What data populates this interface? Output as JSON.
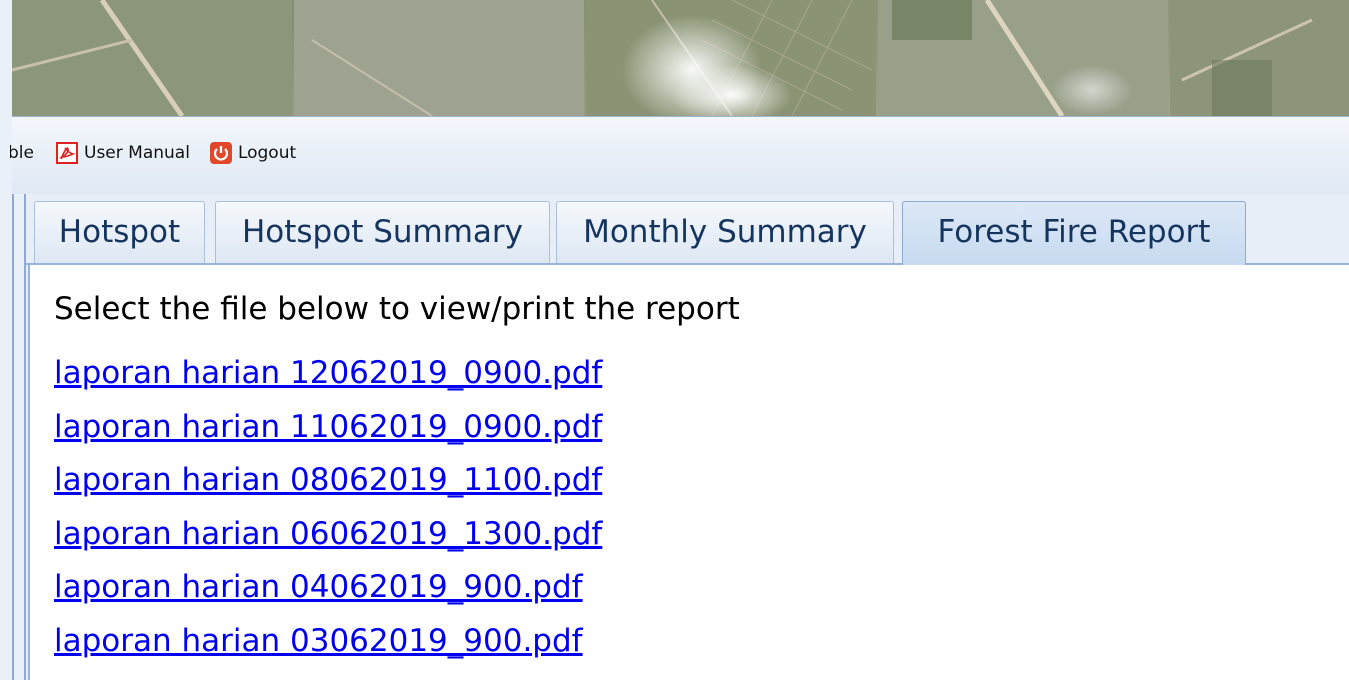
{
  "toolbar": {
    "cut_item_label": "ble",
    "user_manual_label": "User Manual",
    "user_manual_icon": "pdf-icon",
    "logout_label": "Logout",
    "logout_icon": "power-icon"
  },
  "tabs": [
    {
      "label": "Hotspot",
      "active": false
    },
    {
      "label": "Hotspot Summary",
      "active": false
    },
    {
      "label": "Monthly Summary",
      "active": false
    },
    {
      "label": "Forest Fire Report",
      "active": true
    }
  ],
  "report": {
    "instructions": "Select the file below to view/print the report",
    "files": [
      "laporan harian 12062019_0900.pdf",
      "laporan harian 11062019_0900.pdf",
      "laporan harian 08062019_1100.pdf",
      "laporan harian 06062019_1300.pdf",
      "laporan harian 04062019_900.pdf",
      "laporan harian 03062019_900.pdf"
    ]
  },
  "colors": {
    "link": "#0000ee",
    "tab_active": "#c8daf0",
    "frame": "#8eaad0"
  }
}
